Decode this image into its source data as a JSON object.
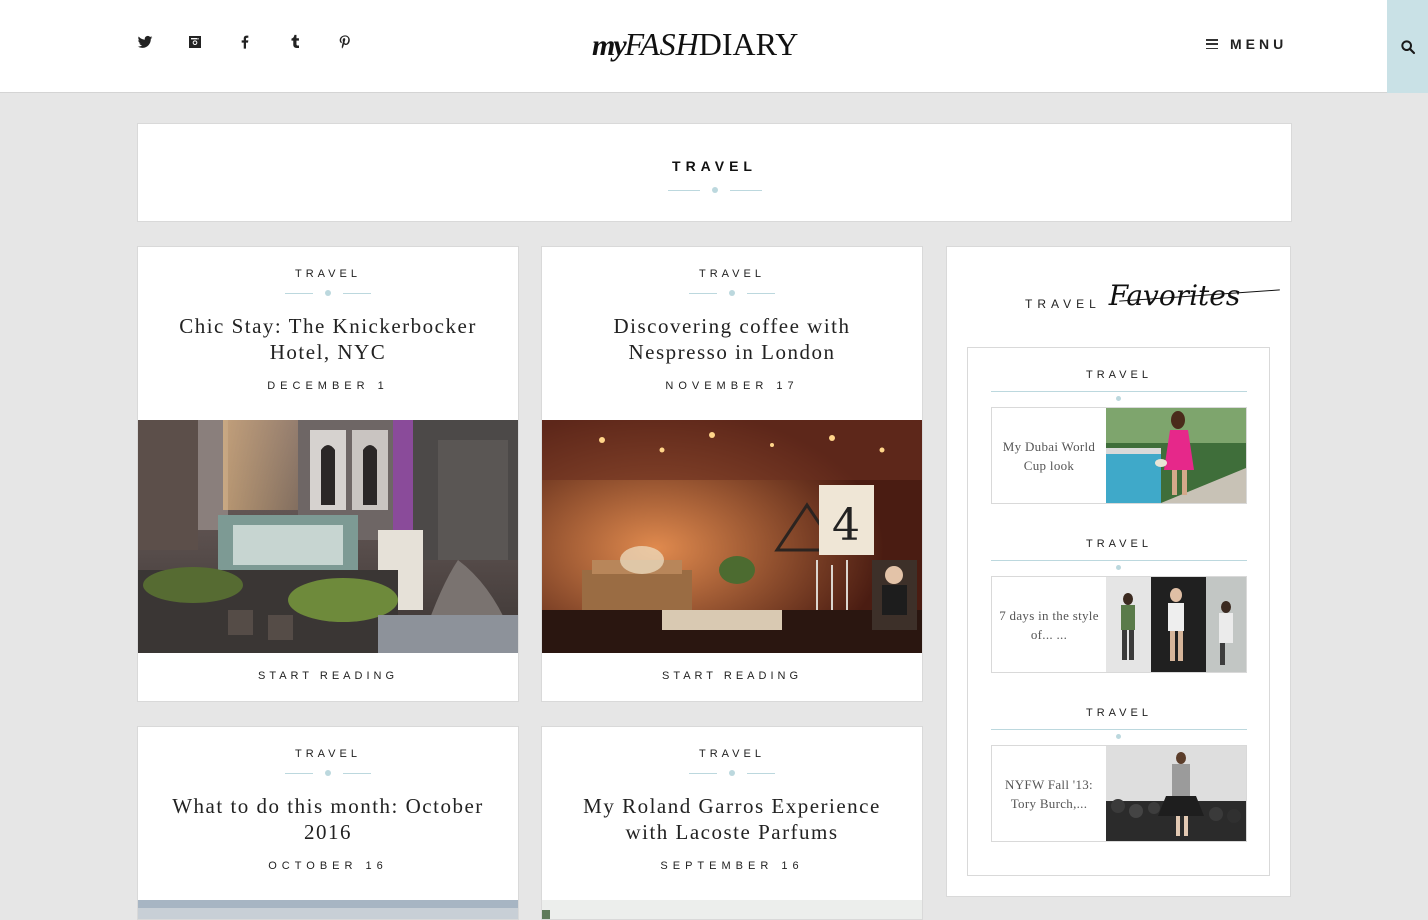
{
  "header": {
    "social_icons": [
      "twitter-icon",
      "instagram-icon",
      "facebook-icon",
      "tumblr-icon",
      "pinterest-icon"
    ],
    "logo": {
      "my": "my",
      "fash": "FASH",
      "diary": "DIARY"
    },
    "menu_label": "MENU",
    "search_icon": "search-icon",
    "accent_color": "#c9e1e6"
  },
  "category_banner": {
    "title": "TRAVEL"
  },
  "posts": [
    {
      "category": "TRAVEL",
      "title": "Chic Stay: The Knickerbocker Hotel, NYC",
      "date": "DECEMBER 1",
      "cta": "START READING"
    },
    {
      "category": "TRAVEL",
      "title": "Discovering coffee with Nespresso in London",
      "date": "NOVEMBER 17",
      "cta": "START READING"
    },
    {
      "category": "TRAVEL",
      "title": "What to do this month: October 2016",
      "date": "OCTOBER 16"
    },
    {
      "category": "TRAVEL",
      "title": "My Roland Garros Experience with Lacoste Parfums",
      "date": "SEPTEMBER 16"
    }
  ],
  "sidebar": {
    "heading_travel": "TRAVEL",
    "heading_script": "Favorites",
    "items": [
      {
        "category": "TRAVEL",
        "title": "My Dubai World Cup look"
      },
      {
        "category": "TRAVEL",
        "title": "7 days in the style of... ..."
      },
      {
        "category": "TRAVEL",
        "title": "NYFW Fall '13: Tory Burch,..."
      }
    ]
  }
}
